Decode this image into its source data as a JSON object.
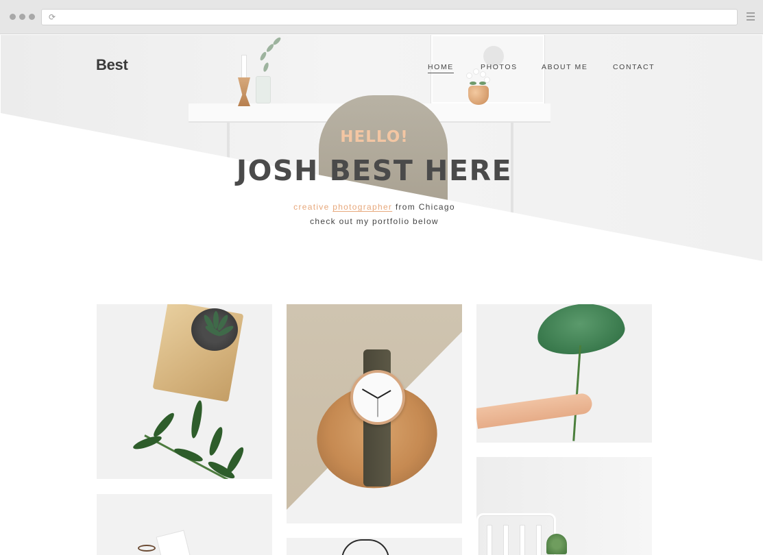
{
  "browser": {
    "address_value": "",
    "icons": {
      "dots": "window-dots-icon",
      "reload": "reload-icon",
      "menu": "hamburger-menu-icon"
    },
    "reload_glyph": "⟳"
  },
  "header": {
    "logo": "Best",
    "nav": [
      {
        "label": "HOME",
        "active": true
      },
      {
        "label": "PHOTOS",
        "active": false
      },
      {
        "label": "ABOUT ME",
        "active": false
      },
      {
        "label": "CONTACT",
        "active": false
      }
    ]
  },
  "hero": {
    "greeting": "HELLO!",
    "headline": "JOSH BEST HERE",
    "line1": {
      "word1": "creative",
      "link": "photographer",
      "rest": "from Chicago"
    },
    "line2": "check out my portfolio below"
  },
  "gallery": {
    "photos": [
      {
        "subject": "succulent in wooden planter with leaves"
      },
      {
        "subject": "wristwatch on wood slice"
      },
      {
        "subject": "hand holding caladium leaf"
      },
      {
        "subject": "notebook and glasses"
      },
      {
        "subject": "black cable"
      },
      {
        "subject": "white chair with plant"
      }
    ]
  },
  "colors": {
    "accent": "#e7a77a",
    "greeting": "#f3c6a3",
    "text_dark": "#4a4a4a",
    "chrome_bg": "#e6e6e6"
  }
}
